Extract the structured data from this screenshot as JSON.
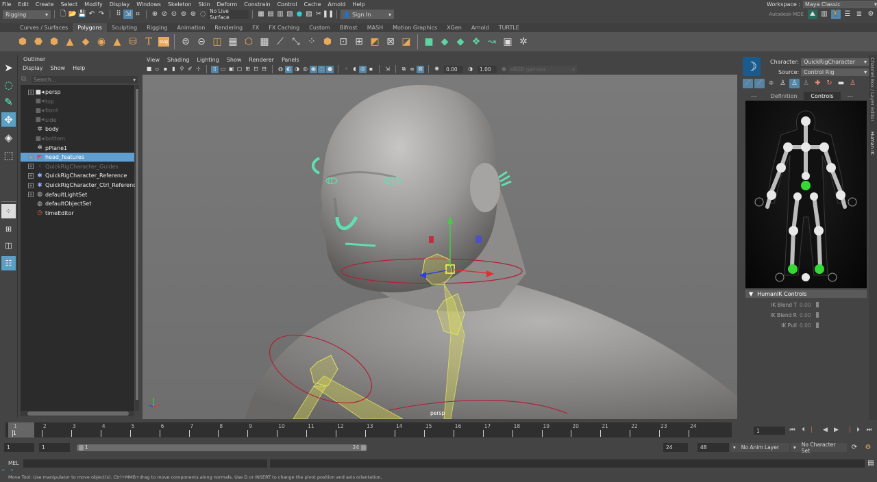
{
  "menubar": {
    "items": [
      "File",
      "Edit",
      "Create",
      "Select",
      "Modify",
      "Display",
      "Windows",
      "Skeleton",
      "Skin",
      "Deform",
      "Constrain",
      "Control",
      "Cache",
      "Arnold",
      "Help"
    ],
    "workspace_label": "Workspace :",
    "workspace_value": "Maya Classic"
  },
  "statusline": {
    "menuset": "Rigging",
    "live_surface": "No Live Surface",
    "sign_in": "Sign In",
    "mde_label": "Autodesk MDE"
  },
  "shelf": {
    "tabs": [
      "Curves / Surfaces",
      "Polygons",
      "Sculpting",
      "Rigging",
      "Animation",
      "Rendering",
      "FX",
      "FX Caching",
      "Custom",
      "Bifrost",
      "MASH",
      "Motion Graphics",
      "XGen",
      "Arnold",
      "TURTLE"
    ],
    "active_tab": "Polygons",
    "svg_label": "svg",
    "text_label": "T"
  },
  "outliner": {
    "title": "Outliner",
    "menu": [
      "Display",
      "Show",
      "Help"
    ],
    "search_placeholder": "Search...",
    "items": [
      {
        "label": "persp",
        "icon": "camera-icon",
        "expandable": true,
        "dim": false,
        "selected": false
      },
      {
        "label": "top",
        "icon": "camera-icon",
        "expandable": false,
        "dim": true,
        "selected": false
      },
      {
        "label": "front",
        "icon": "camera-icon",
        "expandable": false,
        "dim": true,
        "selected": false
      },
      {
        "label": "side",
        "icon": "camera-icon",
        "expandable": false,
        "dim": true,
        "selected": false
      },
      {
        "label": "body",
        "icon": "mesh-icon",
        "expandable": false,
        "dim": false,
        "selected": false
      },
      {
        "label": "bottom",
        "icon": "camera-icon",
        "expandable": false,
        "dim": true,
        "selected": false
      },
      {
        "label": "pPlane1",
        "icon": "mesh-icon",
        "expandable": false,
        "dim": false,
        "selected": false
      },
      {
        "label": "head_features",
        "icon": "curve-icon",
        "expandable": true,
        "dim": false,
        "selected": true
      },
      {
        "label": "QuickRigCharacter_Guides",
        "icon": "guide-icon",
        "expandable": true,
        "dim": true,
        "selected": false
      },
      {
        "label": "QuickRigCharacter_Reference",
        "icon": "joint-icon",
        "expandable": true,
        "dim": false,
        "selected": false
      },
      {
        "label": "QuickRigCharacter_Ctrl_Reference",
        "icon": "joint-icon",
        "expandable": true,
        "dim": false,
        "selected": false
      },
      {
        "label": "defaultLightSet",
        "icon": "set-icon",
        "expandable": true,
        "dim": false,
        "selected": false
      },
      {
        "label": "defaultObjectSet",
        "icon": "set-icon",
        "expandable": false,
        "dim": false,
        "selected": false
      },
      {
        "label": "timeEditor",
        "icon": "time-editor-icon",
        "expandable": false,
        "dim": false,
        "selected": false
      }
    ]
  },
  "viewport": {
    "menu": [
      "View",
      "Shading",
      "Lighting",
      "Show",
      "Renderer",
      "Panels"
    ],
    "exposure": "0.00",
    "gamma": "1.00",
    "color_space": "sRGB gamma",
    "camera_label": "persp"
  },
  "humanik": {
    "character_label": "Character:",
    "character_value": "QuickRigCharacter",
    "source_label": "Source:",
    "source_value": "Control Rig",
    "tabs": [
      "---",
      "Definition",
      "Controls",
      "---"
    ],
    "active_tab": "Controls",
    "section_title": "HumanIK Controls",
    "attrs": [
      {
        "name": "IK Blend T",
        "value": "0.00"
      },
      {
        "name": "IK Blend R",
        "value": "0.00"
      },
      {
        "name": "IK Pull",
        "value": "0.00"
      }
    ],
    "side_tabs": [
      "Channel Box / Layer Editor",
      "Human IK"
    ]
  },
  "timeline": {
    "ticks": [
      "1",
      "2",
      "3",
      "4",
      "5",
      "6",
      "7",
      "8",
      "9",
      "10",
      "11",
      "12",
      "13",
      "14",
      "15",
      "16",
      "17",
      "18",
      "19",
      "20",
      "21",
      "22",
      "23",
      "24"
    ],
    "current_frame": "1",
    "current_frame_field": "1"
  },
  "range": {
    "start": "1",
    "playback_start": "1",
    "slider_start": "1",
    "slider_end": "24",
    "playback_end": "24",
    "end": "48",
    "anim_layer": "No Anim Layer",
    "character_set": "No Character Set"
  },
  "commandline": {
    "label": "MEL"
  },
  "helpline": {
    "text": "Move Tool: Use manipulator to move object(s). Ctrl+MMB+drag to move components along normals. Use D or INSERT to change the pivot position and axis orientation."
  }
}
